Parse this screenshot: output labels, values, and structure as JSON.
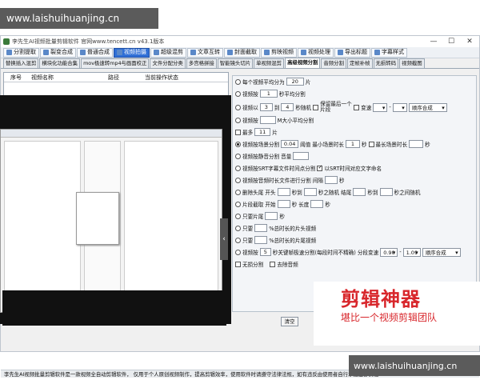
{
  "watermark_top": "www.laishuihuanjing.cn",
  "watermark_bottom": "www.laishuihuanjing.cn",
  "window": {
    "title": "李先生AI视频批量剪辑软件    官网www.tencett.cn    v43.1版本",
    "min": "—",
    "max": "☐",
    "close": "✕"
  },
  "toolbar": [
    {
      "label": "分割提取",
      "active": false
    },
    {
      "label": "裂变合成",
      "active": false
    },
    {
      "label": "普通合成",
      "active": false
    },
    {
      "label": "视频拍摄",
      "active": true
    },
    {
      "label": "超级混剪",
      "active": false
    },
    {
      "label": "文章互转",
      "active": false
    },
    {
      "label": "封面截取",
      "active": false
    },
    {
      "label": "剪映视频",
      "active": false
    },
    {
      "label": "视频处理",
      "active": false
    },
    {
      "label": "导出标题",
      "active": false
    },
    {
      "label": "字幕样式",
      "active": false
    }
  ],
  "tabs": [
    {
      "label": "替换插入混剪",
      "active": false
    },
    {
      "label": "横块化功能合集",
      "active": false
    },
    {
      "label": "mov极速转mp4与画面校正",
      "active": false
    },
    {
      "label": "文件分配分类",
      "active": false
    },
    {
      "label": "多宫格拼接",
      "active": false
    },
    {
      "label": "智能镜头切片",
      "active": false
    },
    {
      "label": "单视频混剪",
      "active": false
    },
    {
      "label": "高级视频分割",
      "active": true
    },
    {
      "label": "音频分割",
      "active": false
    },
    {
      "label": "定帧补帧",
      "active": false
    },
    {
      "label": "无损转码",
      "active": false
    },
    {
      "label": "视频截图",
      "active": false
    }
  ],
  "table": {
    "col_index": "序号",
    "col_name": "视频名称",
    "col_path": "路径",
    "col_status": "当前操作状态"
  },
  "clear_button": "清空",
  "options": {
    "r1": {
      "a": "每个视频平均分为",
      "v": "20",
      "b": "片"
    },
    "r2": {
      "a": "视频按",
      "v": "1",
      "b": "秒平均分割"
    },
    "r3": {
      "a": "视频以",
      "v1": "3",
      "mid": "到",
      "v2": "4",
      "b": "秒随机",
      "keep": "保留最后一个片段",
      "speed": "变速",
      "order": "顺序合成"
    },
    "r4": {
      "a": "视频按",
      "b": "M大小平均分割"
    },
    "r5": {
      "a": "最多",
      "v": "11",
      "b": "片"
    },
    "r6": {
      "a": "视频按场景分割",
      "v": "0.04",
      "t": "阈值",
      "min": "最小场景时长",
      "minv": "1",
      "sec": "秒",
      "max": "最长场景时长",
      "secb": "秒"
    },
    "r7": {
      "a": "视频按静音分割",
      "b": "音量"
    },
    "r8": {
      "a": "视频按SRT字幕文件时间点分割",
      "chk": "以SRT时间对应文字命名"
    },
    "r9": {
      "a": "视频按音频时长文件进行分割",
      "b": "间隔",
      "c": "秒"
    },
    "r10": {
      "a": "删除头尾",
      "head": "开头",
      "s1": "秒到",
      "s2": "秒之随机",
      "tail": "结尾",
      "s3": "秒到",
      "s4": "秒之间随机"
    },
    "r11": {
      "a": "片段截取",
      "b": "开始",
      "c": "秒",
      "d": "长度",
      "e": "秒"
    },
    "r12": {
      "a": "只要片尾",
      "b": "秒"
    },
    "r13": {
      "a": "只要",
      "b": "%总时长的片头视频"
    },
    "r14": {
      "a": "只要",
      "b": "%总时长的片尾视频"
    },
    "r15": {
      "a": "视频按",
      "v": "5",
      "b": "秒关键帧极速分割(每段时间不精确)",
      "c": "分段变速",
      "s1": "0.90",
      "dash": "-",
      "s2": "1.09",
      "order": "顺序合成"
    },
    "r16": {
      "a": "无损分割",
      "b": "去除音频"
    }
  },
  "ad": {
    "title": "剪辑神器",
    "sub": "堪比一个视频剪辑团队"
  },
  "status": "李先生AI视频批量剪辑软件是一款视频全自动剪辑软件， 仅用于个人原创视频制作，提高剪辑效率，使用软件时请遵守法律法规，如有违反由使用者自行承担全部责任!",
  "colors": {
    "accent": "#2f6fd6",
    "ad_red": "#d8262b"
  }
}
